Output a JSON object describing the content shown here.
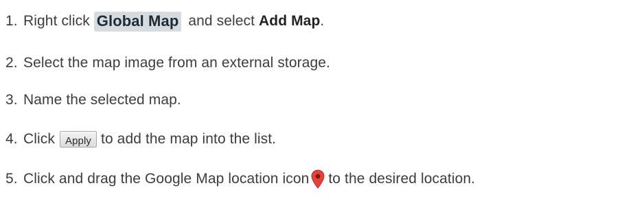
{
  "steps": [
    {
      "number": "1.",
      "prefix": "Right click",
      "chip": "Global Map",
      "middle": "and select",
      "bold": "Add Map",
      "suffix": "."
    },
    {
      "number": "2.",
      "text": "Select the map image from an external storage."
    },
    {
      "number": "3.",
      "text": "Name the selected map."
    },
    {
      "number": "4.",
      "prefix": "Click",
      "button": "Apply",
      "suffix": "to add the map into the list."
    },
    {
      "number": "5.",
      "prefix": "Click and drag the Google Map location icon",
      "icon": "map-location-pin-icon",
      "suffix": "to the desired location."
    }
  ],
  "colors": {
    "text": "#3c3c3c",
    "chip_background": "#d6dbe1",
    "pin_red": "#e2443a"
  }
}
